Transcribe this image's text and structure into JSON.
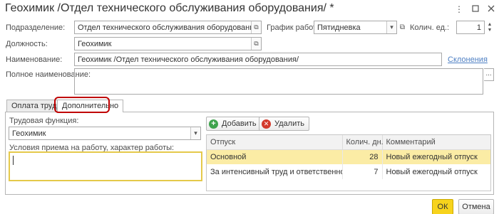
{
  "window": {
    "title": "Геохимик /Отдел технического обслуживания оборудования/ *",
    "more_icon": "more-vert-icon",
    "maximize_icon": "maximize-icon",
    "close_icon": "close-icon"
  },
  "form": {
    "division_label": "Подразделение:",
    "division_value": "Отдел технического обслуживания оборудования",
    "schedule_label": "График работы:",
    "schedule_value": "Пятидневка",
    "units_label": "Колич. ед.:",
    "units_value": "1",
    "position_label": "Должность:",
    "position_value": "Геохимик",
    "name_label": "Наименование:",
    "name_value": "Геохимик /Отдел технического обслуживания оборудования/",
    "declensions_link": "Склонения",
    "full_name_label": "Полное наименование:",
    "full_name_value": "",
    "ellipsis": "..."
  },
  "tabs": [
    {
      "label": "Оплата труда",
      "active": false
    },
    {
      "label": "Дополнительно",
      "active": true
    }
  ],
  "additional": {
    "labor_function_label": "Трудовая функция:",
    "labor_function_value": "Геохимик",
    "conditions_label": "Условия приема на работу, характер работы:",
    "conditions_value": ""
  },
  "vacations": {
    "add_label": "Добавить",
    "delete_label": "Удалить",
    "columns": [
      "Отпуск",
      "Колич. дн.",
      "Комментарий"
    ],
    "rows": [
      {
        "vacation": "Основной",
        "days": "28",
        "comment": "Новый ежегодный отпуск",
        "selected": true
      },
      {
        "vacation": "За интенсивный труд и ответственность",
        "days": "7",
        "comment": "Новый ежегодный отпуск",
        "selected": false
      }
    ]
  },
  "footer": {
    "ok_label": "ОК",
    "cancel_label": "Отмена"
  },
  "colors": {
    "accent_ok": "#f7d31c",
    "highlight_ring": "#c00000",
    "selected_row": "#fbeca5",
    "link": "#4d7fc3",
    "focus_border": "#e5c94a"
  }
}
